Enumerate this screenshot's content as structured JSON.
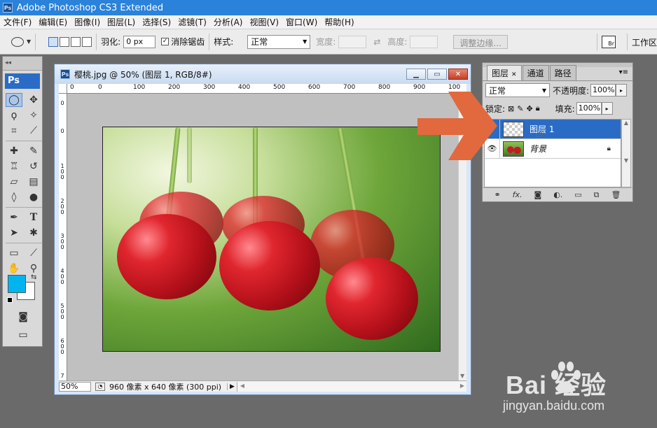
{
  "window": {
    "title": "Adobe Photoshop CS3 Extended",
    "logo": "Ps"
  },
  "menu": [
    "文件(F)",
    "编辑(E)",
    "图像(I)",
    "图层(L)",
    "选择(S)",
    "滤镜(T)",
    "分析(A)",
    "视图(V)",
    "窗口(W)",
    "帮助(H)"
  ],
  "options": {
    "feather_label": "羽化:",
    "feather_value": "0 px",
    "antialias_label": "消除锯齿",
    "antialias_checked": "✓",
    "style_label": "样式:",
    "style_value": "正常",
    "width_label": "宽度:",
    "height_label": "高度:",
    "refine_edge": "调整边缘...",
    "workspace": "工作区",
    "bridge_icon": "Br"
  },
  "toolbox": {
    "brand": "Ps"
  },
  "document": {
    "title": "樱桃.jpg @ 50% (图层 1, RGB/8#)",
    "zoom": "50%",
    "info": "960 像素 x 640 像素 (300 ppi)",
    "ruler_h": [
      "0",
      "0",
      "100",
      "200",
      "300",
      "400",
      "500",
      "600",
      "700",
      "800",
      "900",
      "100"
    ],
    "ruler_v": [
      "0",
      "0",
      "1 0 0",
      "2 0 0",
      "3 0 0",
      "4 0 0",
      "5 0 0",
      "6 0 0",
      "7"
    ]
  },
  "layers_panel": {
    "tabs": [
      "图层",
      "通道",
      "路径"
    ],
    "blend_mode": "正常",
    "opacity_label": "不透明度:",
    "opacity_value": "100%",
    "lock_label": "锁定:",
    "fill_label": "填充:",
    "fill_value": "100%",
    "layers": [
      {
        "name": "图层 1",
        "selected": true
      },
      {
        "name": "背景",
        "selected": false
      }
    ],
    "bottom_icons": [
      "link-icon",
      "fx-icon",
      "mask-icon",
      "adjustment-icon",
      "folder-icon",
      "new-layer-icon",
      "trash-icon"
    ]
  },
  "colors": {
    "foreground": "#00b4f0",
    "background": "#ffffff",
    "accent_arrow": "#e2683d",
    "titlebar": "#2a82db",
    "selection": "#2a6cc5"
  },
  "watermark": {
    "brand": "Bai  经验",
    "url": "jingyan.baidu.com"
  }
}
